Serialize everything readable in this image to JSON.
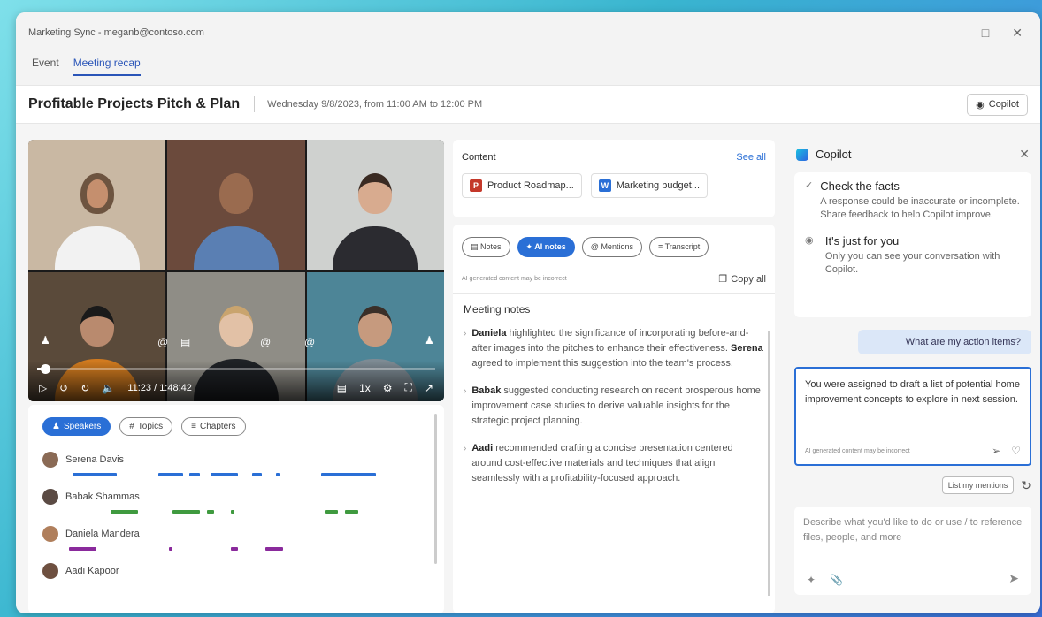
{
  "window": {
    "title": "Marketing Sync - meganb@contoso.com"
  },
  "tabs": [
    {
      "label": "Event"
    },
    {
      "label": "Meeting recap"
    }
  ],
  "header": {
    "title": "Profitable Projects Pitch & Plan",
    "datetime": "Wednesday 9/8/2023, from 11:00 AM to 12:00 PM",
    "copilot_label": "Copilot"
  },
  "video": {
    "time": "11:23 / 1:48:42",
    "speed": "1x",
    "progress": 0.02
  },
  "speakers": {
    "pills": [
      {
        "label": "Speakers"
      },
      {
        "label": "Topics"
      },
      {
        "label": "Chapters"
      }
    ],
    "people": [
      {
        "name": "Serena Davis",
        "color": "#2a6fd6",
        "segments": [
          [
            0.02,
            0.15
          ],
          [
            0.27,
            0.34
          ],
          [
            0.36,
            0.39
          ],
          [
            0.42,
            0.5
          ],
          [
            0.54,
            0.57
          ],
          [
            0.61,
            0.62
          ],
          [
            0.74,
            0.9
          ]
        ]
      },
      {
        "name": "Babak Shammas",
        "color": "#3f9a3f",
        "segments": [
          [
            0.13,
            0.21
          ],
          [
            0.31,
            0.39
          ],
          [
            0.41,
            0.43
          ],
          [
            0.48,
            0.49
          ],
          [
            0.75,
            0.79
          ],
          [
            0.81,
            0.85
          ]
        ]
      },
      {
        "name": "Daniela Mandera",
        "color": "#8a2a9c",
        "segments": [
          [
            0.01,
            0.09
          ],
          [
            0.3,
            0.31
          ],
          [
            0.48,
            0.5
          ],
          [
            0.58,
            0.63
          ]
        ]
      },
      {
        "name": "Aadi Kapoor",
        "color": "#2a6fd6",
        "segments": []
      }
    ]
  },
  "content": {
    "title": "Content",
    "see_all": "See all",
    "files": [
      {
        "name": "Product Roadmap...",
        "type": "ppt",
        "color": "#c4382a"
      },
      {
        "name": "Marketing budget...",
        "type": "word",
        "color": "#2a6fd6"
      }
    ]
  },
  "notes": {
    "tabs": [
      {
        "label": "Notes"
      },
      {
        "label": "AI notes"
      },
      {
        "label": "Mentions"
      },
      {
        "label": "Transcript"
      }
    ],
    "disclaimer": "AI generated content may be incorrect",
    "copy_all": "Copy all",
    "title": "Meeting notes",
    "items": [
      {
        "name": "Daniela",
        "text1": " highlighted the significance of incorporating before-and-after images into the pitches to enhance their effectiveness. ",
        "name2": "Serena",
        "text2": " agreed to implement this suggestion into the team's process."
      },
      {
        "name": "Babak",
        "text1": " suggested conducting research on recent prosperous home improvement case studies to derive valuable insights for the strategic project planning.",
        "name2": "",
        "text2": ""
      },
      {
        "name": "Aadi",
        "text1": " recommended crafting a concise presentation centered around cost-effective materials and techniques that align seamlessly with a profitability-focused approach.",
        "name2": "",
        "text2": ""
      }
    ]
  },
  "copilot": {
    "title": "Copilot",
    "facts_title": "Check the facts",
    "facts_desc": "A response could be inaccurate or incomplete. Share feedback to help Copilot improve.",
    "private_title": "It's just for you",
    "private_desc": "Only you can see your conversation with Copilot.",
    "user_message": "What are my action items?",
    "ai_response": "You were assigned to draft a list of potential home improvement concepts to explore in next session.",
    "ai_disclaimer": "AI generated content may be incorrect",
    "suggestion": "List my mentions",
    "composer_placeholder": "Describe what you'd like to do or use / to reference files, people, and more"
  },
  "colors": {
    "accent": "#2a6fd6",
    "brand_gradient_start": "#19c1e0",
    "brand_gradient_end": "#2e62e0"
  }
}
